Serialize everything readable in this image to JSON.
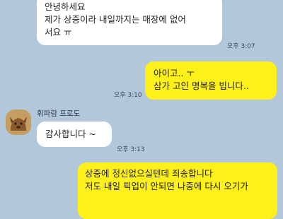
{
  "colors": {
    "background": "#b2c7d9",
    "incoming_bubble": "#ffffff",
    "outgoing_bubble": "#fef01b"
  },
  "messages": [
    {
      "direction": "incoming",
      "text": "안녕하세요\n제가 상중이라 내일까지는 매장에 없어\n서요 ㅠ",
      "time": "오후 3:07"
    },
    {
      "direction": "outgoing",
      "text": "아이고.. ㅜ\n삼가 고인 명복을 빕니다..",
      "time": "오후 3:10"
    },
    {
      "direction": "incoming",
      "sender": "휘파람 프로도",
      "avatar_icon": "frodo-character-icon",
      "text": "감사합니다 ~",
      "time": "오후 3:13"
    },
    {
      "direction": "outgoing",
      "text": "상중에 정신없으실텐데 죄송합니다\n저도 내일 픽업이 안되면 나중에 다시 오기가"
    }
  ]
}
